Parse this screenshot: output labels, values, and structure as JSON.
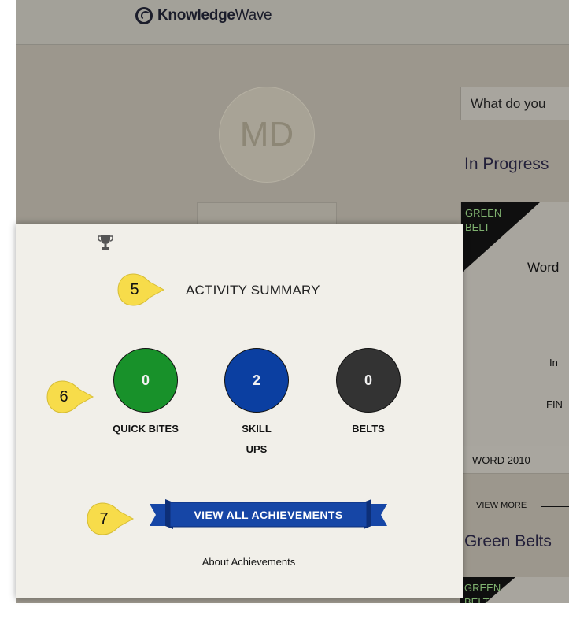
{
  "header": {
    "logo_bold": "Knowledge",
    "logo_light": "Wave"
  },
  "profile": {
    "initials": "MD"
  },
  "search": {
    "placeholder": "What do you"
  },
  "sections": {
    "in_progress": "In Progress",
    "green_belts": "Green Belts"
  },
  "course_card": {
    "badge_line1": "GREEN",
    "badge_line2": "BELT",
    "title": "Word",
    "status": "In",
    "finish": "FIN",
    "footer": "WORD 2010"
  },
  "view_more": "VIEW MORE",
  "course_card_2": {
    "badge_line1": "GREEN",
    "badge_line2": "BELT"
  },
  "activity_panel": {
    "title": "ACTIVITY SUMMARY",
    "stats": [
      {
        "count": "0",
        "label_line1": "QUICK BITES",
        "label_line2": "",
        "color": "#18912a"
      },
      {
        "count": "2",
        "label_line1": "SKILL",
        "label_line2": "UPS",
        "color": "#0b3fa1"
      },
      {
        "count": "0",
        "label_line1": "BELTS",
        "label_line2": "",
        "color": "#333333"
      }
    ],
    "view_all_button": "VIEW ALL ACHIEVEMENTS",
    "about_link": "About Achievements"
  },
  "callouts": [
    "5",
    "6",
    "7"
  ],
  "colors": {
    "callout": "#f7dc4a",
    "banner": "#1646a6",
    "banner_dark": "#0d2f78",
    "panel": "#f1efe9",
    "page_overlay": "#9c978d"
  }
}
